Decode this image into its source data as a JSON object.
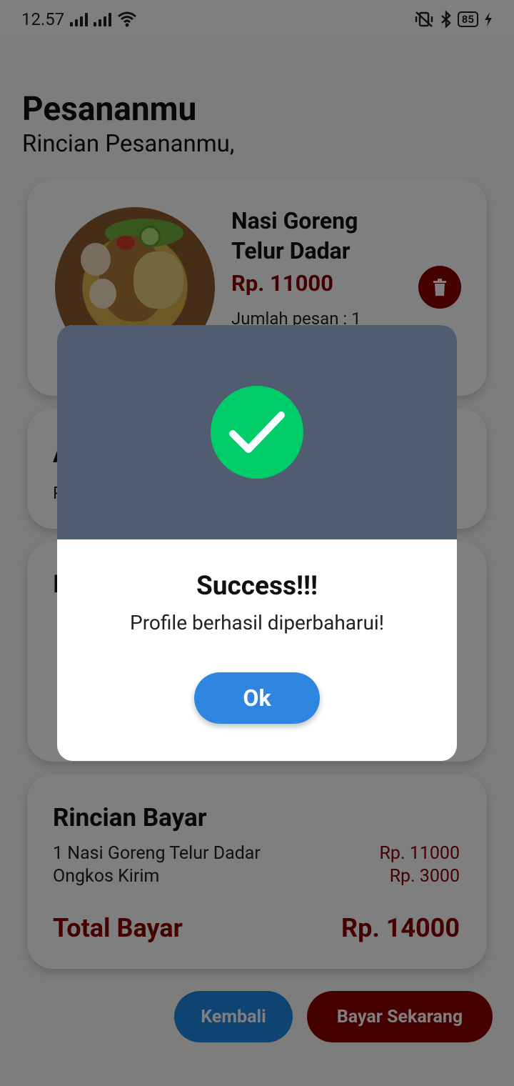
{
  "status": {
    "time": "12.57",
    "battery": "85"
  },
  "page": {
    "title": "Pesananmu",
    "subtitle": "Rincian Pesananmu,"
  },
  "order": {
    "name": "Nasi Goreng Telur Dadar",
    "price": "Rp. 11000",
    "qty": "Jumlah pesan : 1"
  },
  "address": {
    "title": "A",
    "line": "P"
  },
  "payment": {
    "title": "I"
  },
  "bill": {
    "title": "Rincian Bayar",
    "item_label": "1 Nasi Goreng Telur Dadar",
    "item_value": "Rp. 11000",
    "shipping_label": "Ongkos Kirim",
    "shipping_value": "Rp. 3000",
    "total_label": "Total Bayar",
    "total_value": "Rp. 14000"
  },
  "actions": {
    "back_label": "Kembali",
    "pay_label": "Bayar Sekarang"
  },
  "dialog": {
    "title": "Success!!!",
    "message": "Profile berhasil diperbaharui!",
    "ok_label": "Ok"
  },
  "colors": {
    "accent_red": "#8b0000",
    "accent_blue": "#1e88e5",
    "success_green": "#00cc6a",
    "dialog_header": "#505c70"
  }
}
